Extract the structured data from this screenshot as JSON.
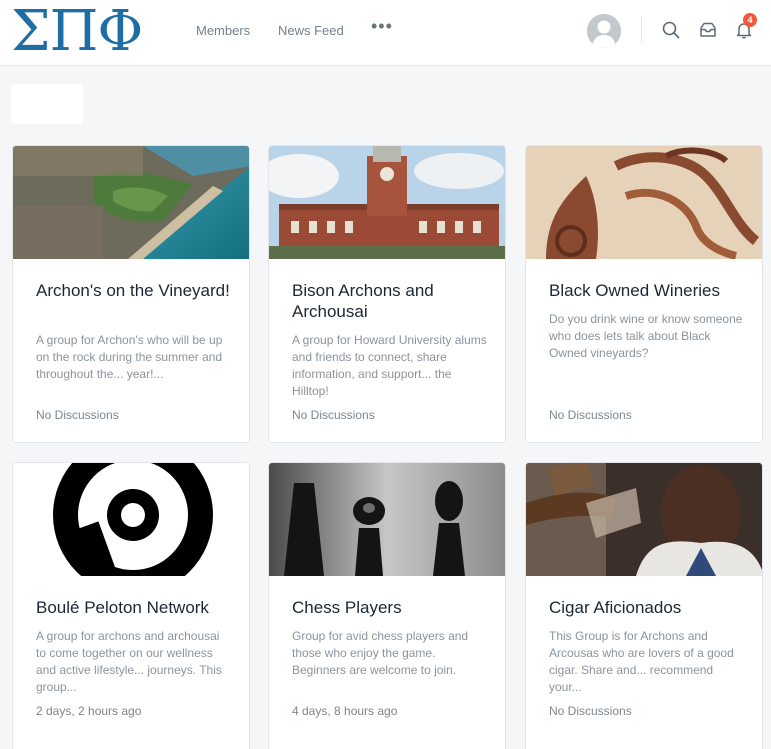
{
  "brand": {
    "logo_text": "ΣΠΦ"
  },
  "nav": {
    "members": "Members",
    "news_feed": "News Feed",
    "more": "•••"
  },
  "notifications": {
    "count": "4"
  },
  "cards": [
    {
      "title": "Archon's on the Vineyard!",
      "desc": "A group for Archon's who will be up on the rock during the summer and throughout the... year!...",
      "meta": "No Discussions",
      "image": "aerial-coast-photo"
    },
    {
      "title": "Bison Archons and Archousai",
      "desc": "A group for Howard University alums and friends to connect, share information, and support... the Hilltop!",
      "meta": "No Discussions",
      "image": "clock-tower-photo"
    },
    {
      "title": "Black Owned Wineries",
      "desc": "Do you drink wine or know someone who does lets talk about Black Owned vineyards?",
      "meta": "No Discussions",
      "image": "wine-art-photo"
    },
    {
      "title": "Boulé Peloton Network",
      "desc": "A group for archons and archousai to come together on our wellness and active lifestyle... journeys. This group...",
      "meta": "2 days, 2 hours ago",
      "image": "peloton-logo"
    },
    {
      "title": "Chess Players",
      "desc": "Group for avid chess players and those who enjoy the game. Beginners are welcome to join.",
      "meta": "4 days, 8 hours ago",
      "image": "chess-photo"
    },
    {
      "title": "Cigar Aficionados",
      "desc": "This Group is for Archons and Arcousas who are lovers of a good cigar. Share and... recommend your...",
      "meta": "No Discussions",
      "image": "cigar-photo"
    }
  ]
}
